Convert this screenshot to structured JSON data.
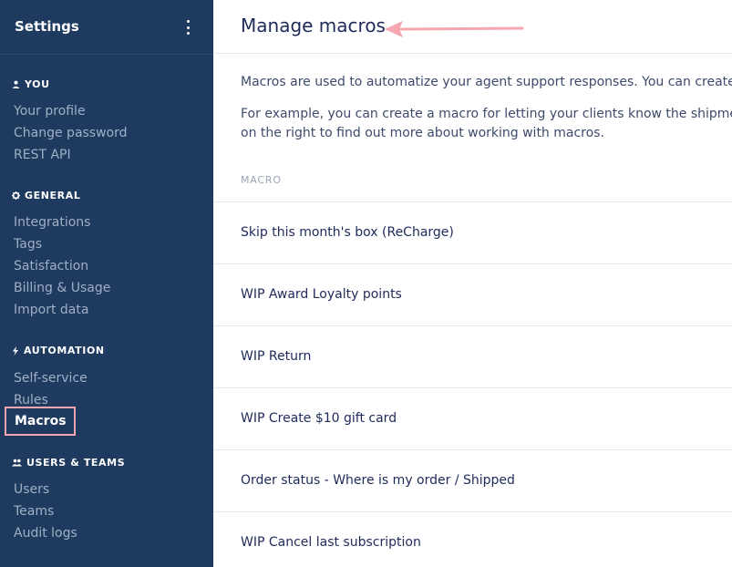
{
  "sidebar": {
    "title": "Settings",
    "sections": [
      {
        "heading": "YOU",
        "icon": "user-icon",
        "items": [
          "Your profile",
          "Change password",
          "REST API"
        ]
      },
      {
        "heading": "GENERAL",
        "icon": "gear-icon",
        "items": [
          "Integrations",
          "Tags",
          "Satisfaction",
          "Billing & Usage",
          "Import data"
        ]
      },
      {
        "heading": "AUTOMATION",
        "icon": "lightning-icon",
        "items": [
          "Self-service",
          "Rules",
          "Macros"
        ]
      },
      {
        "heading": "USERS & TEAMS",
        "icon": "users-icon",
        "items": [
          "Users",
          "Teams",
          "Audit logs"
        ]
      }
    ],
    "active_item": "Macros"
  },
  "main": {
    "title": "Manage macros",
    "intro_line1": "Macros are used to automatize your agent support responses. You can create new",
    "intro_line2": "For example, you can create a macro for letting your clients know the shipment sta",
    "intro_line3": "on the right to find out more about working with macros.",
    "column_header": "MACRO",
    "macros": [
      "Skip this month's box (ReCharge)",
      "WIP Award Loyalty points",
      "WIP Return",
      "WIP Create $10 gift card",
      "Order status - Where is my order / Shipped",
      "WIP Cancel last subscription"
    ]
  },
  "colors": {
    "sidebar_bg": "#1e3a5f",
    "highlight": "#f4a7b0",
    "title_text": "#1e2a5a"
  }
}
